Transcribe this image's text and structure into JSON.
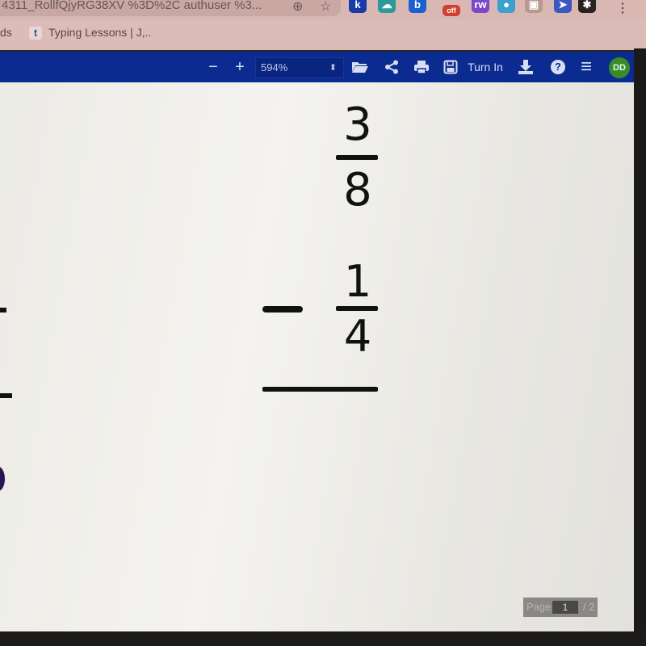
{
  "browser": {
    "url_text": "4311_RollfQjyRG38XV %3D%2C authuser %3...",
    "bookmarks": [
      {
        "label": "ds"
      },
      {
        "label": "Typing Lessons | J,..",
        "favicon": "t"
      }
    ],
    "extensions": [
      {
        "name": "k-extension-icon",
        "label": "k",
        "color": "#1a3aa8"
      },
      {
        "name": "cloud-extension-icon",
        "label": "☁",
        "color": "#2a9a9a"
      },
      {
        "name": "b-extension-icon",
        "label": "b",
        "color": "#1a60d0"
      },
      {
        "name": "off-extension-icon",
        "label": "off",
        "color": "#d04030"
      },
      {
        "name": "rw-extension-icon",
        "label": "rw",
        "color": "#7a48c8"
      },
      {
        "name": "circle-extension-icon",
        "label": "●",
        "color": "#3aa0d0"
      },
      {
        "name": "screenshot-extension-icon",
        "label": "▣",
        "color": "#b89890"
      },
      {
        "name": "cursor-extension-icon",
        "label": "➤",
        "color": "#3a58c0"
      },
      {
        "name": "puzzle-extension-icon",
        "label": "✱",
        "color": "#2a2222"
      }
    ]
  },
  "toolbar": {
    "zoom_out": "−",
    "zoom_in": "+",
    "zoom_level": "594%",
    "zoom_arrows": "⬍",
    "open_icon": "📂",
    "share_icon": "<",
    "print_icon": "🖶",
    "save_icon": "🖫",
    "turn_in_label": "Turn In",
    "download_icon": "⭳",
    "help_icon": "?",
    "menu_icon": "≡",
    "avatar_initials": "DD"
  },
  "document": {
    "fraction1": {
      "numerator": "3",
      "denominator": "8"
    },
    "operator": "−",
    "fraction2": {
      "numerator": "1",
      "denominator": "4"
    }
  },
  "pagination": {
    "label": "Page",
    "current": "1",
    "total": "/ 2"
  }
}
